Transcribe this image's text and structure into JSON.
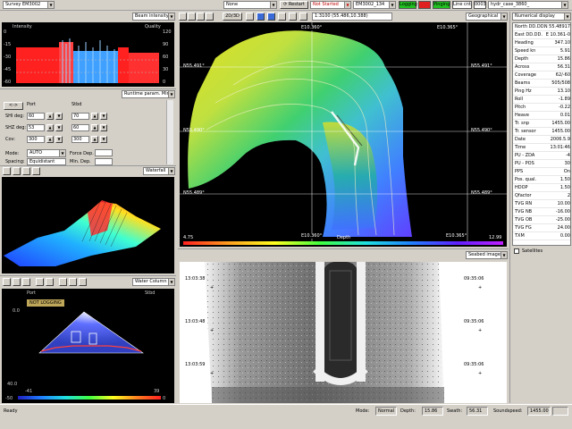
{
  "toolbar": {
    "survey": "Survey EM3002",
    "none": "None",
    "restart": "Restart",
    "not_started": "Not Started",
    "em": "EM3002_134",
    "logging": "Logging",
    "pinging": "Pinging",
    "line_cnt": "Line cnt.",
    "line_num": "0003",
    "file": "hydr_case_3860_",
    "colors": {
      "logging": "#22c022",
      "pinging": "#22c022",
      "red": "#e02020",
      "notstarted": "#c00000"
    }
  },
  "beam_panel": {
    "title": "Beam intensity",
    "intensity_label": "Intensity",
    "quality_label": "Quality",
    "y_left": [
      "0",
      "-15",
      "-30",
      "-45",
      "-60"
    ],
    "y_right": [
      "120",
      "90",
      "60",
      "30",
      "0"
    ]
  },
  "runtime": {
    "title": "Runtime param. Min",
    "arrows": "<->",
    "port": "Port",
    "stbd": "Stbd",
    "rows": [
      {
        "label": "SHI deg:",
        "port": "60",
        "stbd": "70"
      },
      {
        "label": "SHZ deg:",
        "port": "53",
        "stbd": "60"
      },
      {
        "label": "Cov:",
        "port": "300",
        "stbd": "300"
      }
    ],
    "mode_label": "Mode:",
    "mode_value": "AUTO",
    "force_depth": "Force Dep.",
    "spacing_label": "Spacing:",
    "spacing_value": "Equidistant",
    "min_dep": "Min. Dep."
  },
  "waterfall": {
    "title": "Waterfall"
  },
  "water_column": {
    "title": "Water Column",
    "port": "Port",
    "stbd": "Stbd",
    "badge": "NOT LOGGING",
    "y_top": "0.0",
    "y_bottom": "40.0",
    "x_left": "-41",
    "x_right": "39",
    "scale_left": "-50",
    "scale_right": "0"
  },
  "geo": {
    "toolbar_text": "1:3100 (55.486,10.388)",
    "zoom": "2D/3D",
    "title": "Geographical",
    "lon_top_1": "E10.360°",
    "lon_top_2": "E10.365°",
    "lon_bot_1": "E10.360°",
    "lon_bot_2": "E10.365°",
    "lat_1": "N55.491°",
    "lat_2": "N55.490°",
    "lat_3": "N55.489°",
    "lat_r1": "N55.491°",
    "lat_r2": "N55.490°",
    "lat_r3": "N55.489°",
    "depth_min": "4.75",
    "depth_label": "Depth",
    "depth_max": "12.99"
  },
  "seabed": {
    "title": "Seabed image",
    "times_left": [
      "13:03:38",
      "13:03:48",
      "13:03:59"
    ],
    "times_right": [
      "09:35:06",
      "09:35:06",
      "09:35:06"
    ]
  },
  "numerical": {
    "title": "Numerical display",
    "rows": [
      {
        "k": "North DD.DD.",
        "v": "N 55.48917"
      },
      {
        "k": "East DD.DD.",
        "v": "E 10.361-0"
      },
      {
        "k": "Heading",
        "v": "347.10"
      },
      {
        "k": "Speed kn",
        "v": "5.91"
      },
      {
        "k": "Depth",
        "v": "15.86"
      },
      {
        "k": "Across",
        "v": "56.31"
      },
      {
        "k": "Coverage",
        "v": "62/-60"
      },
      {
        "k": "Beams",
        "v": "505/508"
      },
      {
        "k": "Ping Hz",
        "v": "13.10"
      },
      {
        "k": "Roll",
        "v": "-1.89"
      },
      {
        "k": "Pitch",
        "v": "-0.22"
      },
      {
        "k": "Heave",
        "v": "0.01"
      },
      {
        "k": "Tr. snp",
        "v": "1455.00"
      },
      {
        "k": "Tr. sensor",
        "v": "1455.00"
      },
      {
        "k": "Date",
        "v": "2006.5.9"
      },
      {
        "k": "Time",
        "v": "13:01:46"
      },
      {
        "k": "PU - ZDA",
        "v": "-4"
      },
      {
        "k": "PU - POS",
        "v": "30"
      },
      {
        "k": "PPS",
        "v": "On"
      },
      {
        "k": "Pos. qual.",
        "v": "1.50"
      },
      {
        "k": "HDOP",
        "v": "1.50"
      },
      {
        "k": "Qfactor",
        "v": "2"
      },
      {
        "k": "TVG RN",
        "v": "10.00"
      },
      {
        "k": "TVG NB",
        "v": "-16.00"
      },
      {
        "k": "TVG OB",
        "v": "-25.00"
      },
      {
        "k": "TVG FG",
        "v": "24.00"
      },
      {
        "k": "TXM",
        "v": "0.00"
      }
    ],
    "satellites": "Satellites"
  },
  "statusbar": {
    "ready": "Ready",
    "mode_label": "Mode:",
    "mode_value": "Normal",
    "depth_label": "Depth:",
    "depth_value": "15.86",
    "swath_label": "Swath:",
    "swath_value": "56.31",
    "soundspeed_label": "Soundspeed:",
    "soundspeed_value": "1455.00"
  }
}
